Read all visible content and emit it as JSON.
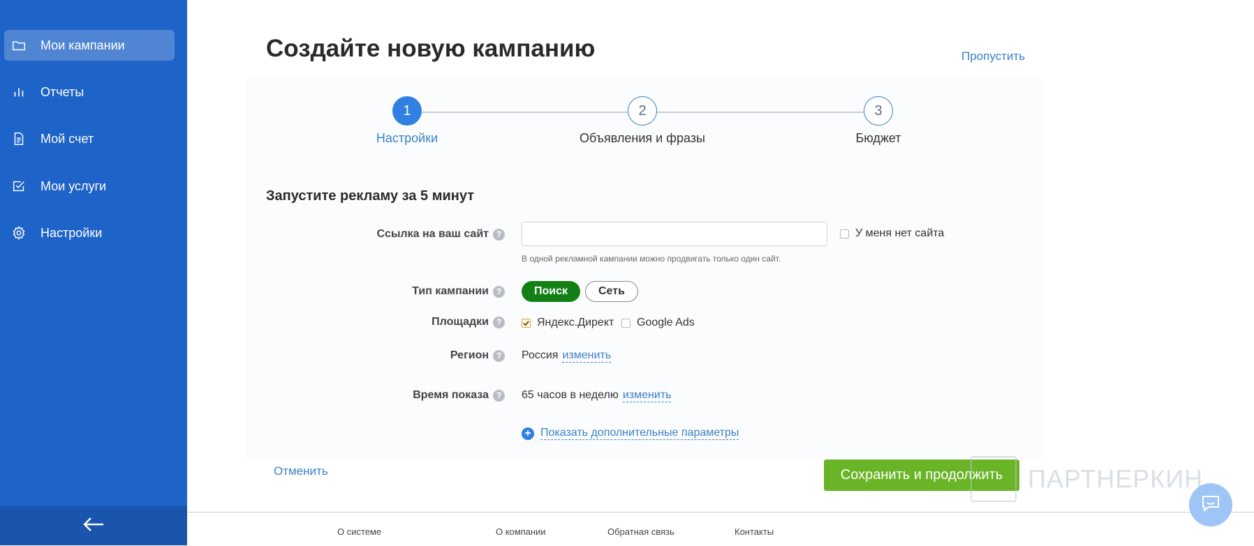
{
  "sidebar": {
    "items": [
      {
        "label": "Мои кампании",
        "icon": "folder-icon",
        "active": true
      },
      {
        "label": "Отчеты",
        "icon": "bar-chart-icon",
        "active": false
      },
      {
        "label": "Мой счет",
        "icon": "document-icon",
        "active": false
      },
      {
        "label": "Мои услуги",
        "icon": "checkbox-icon",
        "active": false
      },
      {
        "label": "Настройки",
        "icon": "gear-icon",
        "active": false
      }
    ],
    "collapse_icon": "arrow-left-icon"
  },
  "header": {
    "title": "Создайте новую кампанию",
    "skip_label": "Пропустить"
  },
  "stepper": {
    "steps": [
      {
        "number": "1",
        "label": "Настройки",
        "active": true
      },
      {
        "number": "2",
        "label": "Объявления и фразы",
        "active": false
      },
      {
        "number": "3",
        "label": "Бюджет",
        "active": false
      }
    ]
  },
  "form": {
    "section_title": "Запустите рекламу за 5 минут",
    "site_url": {
      "label": "Ссылка на ваш сайт",
      "value": "",
      "placeholder": "",
      "hint": "В одной рекламной кампании можно продвигать только один сайт.",
      "no_site_label": "У меня нет сайта",
      "no_site_checked": false
    },
    "campaign_type": {
      "label": "Тип кампании",
      "options": [
        "Поиск",
        "Сеть"
      ],
      "selected": "Поиск"
    },
    "platforms": {
      "label": "Площадки",
      "items": [
        {
          "label": "Яндекс.Директ",
          "checked": true
        },
        {
          "label": "Google Ads",
          "checked": false
        }
      ]
    },
    "region": {
      "label": "Регион",
      "value": "Россия",
      "change_label": "изменить"
    },
    "show_time": {
      "label": "Время показа",
      "value": "65 часов в неделю",
      "change_label": "изменить"
    },
    "more_params_label": "Показать дополнительные параметры",
    "help_glyph": "?"
  },
  "actions": {
    "cancel_label": "Отменить",
    "save_label": "Сохранить и продолжить"
  },
  "watermark": "ПАРТНЕРКИН",
  "footer": {
    "links": [
      "О системе",
      "О компании",
      "Обратная связь",
      "Контакты"
    ]
  },
  "chat_icon": "chat-icon",
  "colors": {
    "sidebar": "#1e63c7",
    "accent": "#3a82c7",
    "step_active": "#2f80e0",
    "pill_active": "#138016",
    "save_button": "#6ab427"
  }
}
